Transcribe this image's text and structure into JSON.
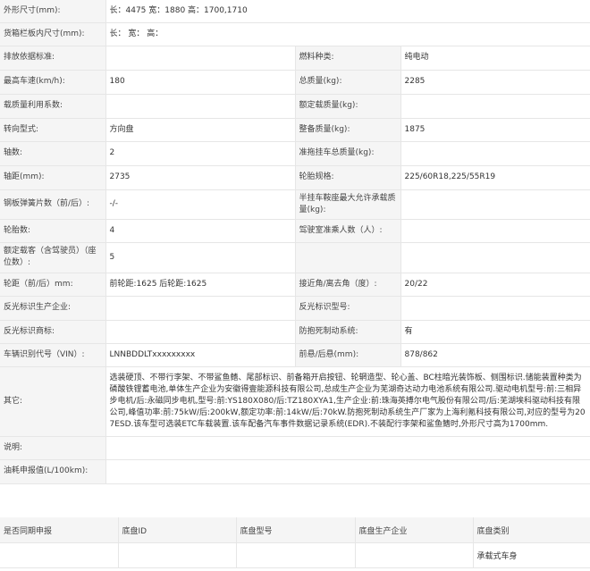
{
  "rows": [
    {
      "type": "full",
      "label": "外形尺寸(mm):",
      "value": "长：4475 宽：1880 高：1700,1710"
    },
    {
      "type": "full",
      "label": "货箱栏板内尺寸(mm):",
      "value": "长：  宽：  高："
    },
    {
      "type": "pair",
      "l1": "排放依据标准:",
      "v1": "",
      "l2": "燃料种类:",
      "v2": "纯电动"
    },
    {
      "type": "pair",
      "l1": "最高车速(km/h):",
      "v1": "180",
      "l2": "总质量(kg):",
      "v2": "2285"
    },
    {
      "type": "pair",
      "l1": "载质量利用系数:",
      "v1": "",
      "l2": "额定载质量(kg):",
      "v2": ""
    },
    {
      "type": "pair",
      "l1": "转向型式:",
      "v1": "方向盘",
      "l2": "整备质量(kg):",
      "v2": "1875"
    },
    {
      "type": "pair",
      "l1": "轴数:",
      "v1": "2",
      "l2": "准拖挂车总质量(kg):",
      "v2": ""
    },
    {
      "type": "pair",
      "l1": "轴距(mm):",
      "v1": "2735",
      "l2": "轮胎规格:",
      "v2": "225/60R18,225/55R19"
    },
    {
      "type": "pair",
      "l1": "钢板弹簧片数（前/后）:",
      "v1": "-/-",
      "l2": "半挂车鞍座最大允许承载质量(kg):",
      "v2": ""
    },
    {
      "type": "pair",
      "l1": "轮胎数:",
      "v1": "4",
      "l2": "驾驶室准乘人数（人）:",
      "v2": ""
    },
    {
      "type": "pair",
      "l1": "额定载客（含驾驶员）（座位数）:",
      "v1": "5",
      "l2": "",
      "v2": ""
    },
    {
      "type": "pair",
      "l1": "轮距（前/后）mm:",
      "v1": "前轮距:1625 后轮距:1625",
      "l2": "接近角/离去角（度）:",
      "v2": "20/22"
    },
    {
      "type": "pair",
      "l1": "反光标识生产企业:",
      "v1": "",
      "l2": "反光标识型号:",
      "v2": ""
    },
    {
      "type": "pair",
      "l1": "反光标识商标:",
      "v1": "",
      "l2": "防抱死制动系统:",
      "v2": "有"
    },
    {
      "type": "pair",
      "l1": "车辆识别代号（VIN）:",
      "v1": "LNNBDDLTxxxxxxxxx",
      "l2": "前悬/后悬(mm):",
      "v2": "878/862"
    },
    {
      "type": "full",
      "label": "其它:",
      "value": "选装硬顶、不带行李架、不带鲨鱼鳍、尾部标识、前备箱开启按钮、轮辋造型、轮心盖、BC柱暗光装饰板、侧围标识.储能装置种类为磷酸铁锂蓄电池,单体生产企业为安徽得壹能源科技有限公司,总成生产企业为芜湖奇达动力电池系统有限公司.驱动电机型号:前:三相异步电机/后:永磁同步电机,型号:前:YS180X080/后:TZ180XYA1,生产企业:前:珠海英搏尔电气股份有限公司/后:芜湖埃科驱动科技有限公司,峰值功率:前:75kW/后:200kW,额定功率:前:14kW/后:70kW.防抱死制动系统生产厂家为上海利氪科技有限公司,对应的型号为207ESD.该车型可选装ETC车载装置.该车配备汽车事件数据记录系统(EDR).不装配行李架和鲨鱼鳍时,外形尺寸高为1700mm."
    },
    {
      "type": "full",
      "label": "说明:",
      "value": ""
    },
    {
      "type": "full",
      "label": "油耗申报值(L/100km):",
      "value": ""
    }
  ],
  "chassis": {
    "headers": [
      "是否同期申报",
      "底盘ID",
      "底盘型号",
      "底盘生产企业",
      "底盘类别"
    ],
    "cells": [
      "",
      "",
      "",
      "",
      "承载式车身"
    ]
  }
}
